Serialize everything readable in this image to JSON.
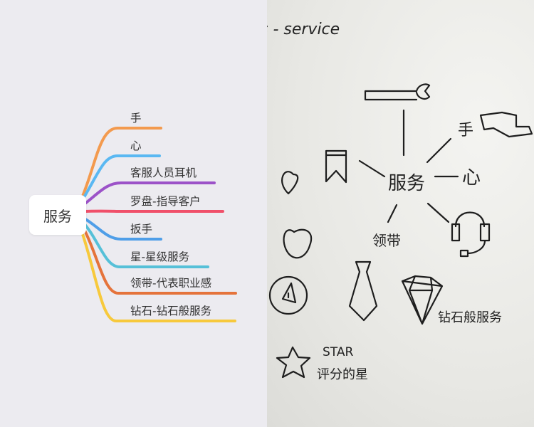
{
  "mindmap": {
    "root": "服务",
    "branches": [
      {
        "label": "手",
        "color": "#f39a4e"
      },
      {
        "label": "心",
        "color": "#5ab8f2"
      },
      {
        "label": "客服人员耳机",
        "color": "#9c52c8"
      },
      {
        "label": "罗盘-指导客户",
        "color": "#f0506a"
      },
      {
        "label": "扳手",
        "color": "#4f9ee8"
      },
      {
        "label": "星-星级服务",
        "color": "#56c0d8"
      },
      {
        "label": "领带-代表职业感",
        "color": "#e5733b"
      },
      {
        "label": "钻石-钻石般服务",
        "color": "#f7c93c"
      }
    ]
  },
  "sketch": {
    "title": "s - service",
    "center": "服务",
    "hand": "手",
    "heart": "心",
    "tie": "领带",
    "diamond": "钻石般服务",
    "star_en": "STAR",
    "star_cn": "评分的星"
  }
}
